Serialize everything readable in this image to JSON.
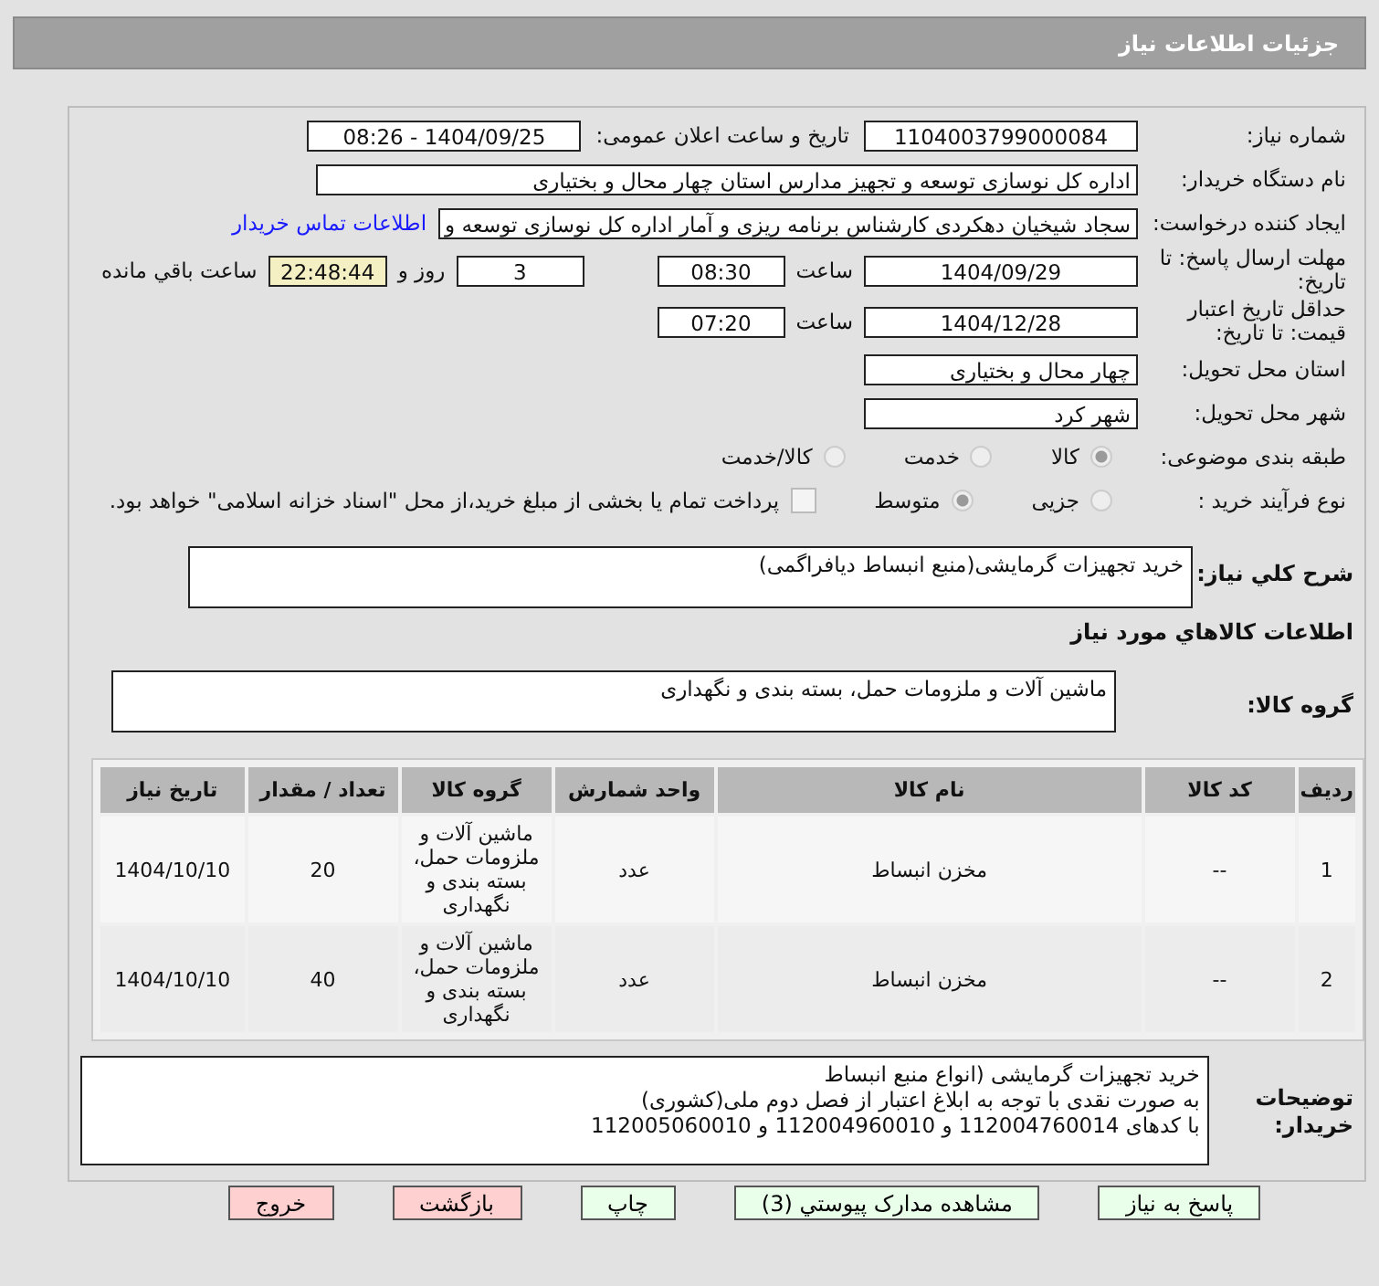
{
  "header": {
    "title": "جزئیات اطلاعات نیاز"
  },
  "need_number": {
    "label": "شماره نیاز:",
    "value": "1104003799000084"
  },
  "announce": {
    "label": "تاریخ و ساعت اعلان عمومی:",
    "value": "1404/09/25 - 08:26"
  },
  "buyer": {
    "label": "نام دستگاه خریدار:",
    "value": "اداره کل نوسازی  توسعه و تجهیز مدارس استان چهار محال و بختیاری"
  },
  "creator": {
    "label": "ایجاد کننده درخواست:",
    "value": "سجاد شیخیان دهکردی کارشناس برنامه ریزی و آمار اداره کل نوسازی  توسعه و",
    "link": "اطلاعات تماس خریدار"
  },
  "deadline": {
    "label": "مهلت ارسال پاسخ: تا تاریخ:",
    "date": "1404/09/29",
    "time_label": "ساعت",
    "time": "08:30",
    "days": "3",
    "days_label": "روز و",
    "remaining": "22:48:44",
    "remaining_label": "ساعت باقي مانده"
  },
  "validity": {
    "label": "حداقل تاریخ اعتبار قیمت: تا تاریخ:",
    "date": "1404/12/28",
    "time_label": "ساعت",
    "time": "07:20"
  },
  "province": {
    "label": "استان محل تحویل:",
    "value": "چهار محال و بختیاری"
  },
  "city": {
    "label": "شهر محل تحویل:",
    "value": "شهر کرد"
  },
  "category": {
    "label": "طبقه بندی موضوعی:",
    "options": [
      {
        "label": "کالا",
        "selected": true
      },
      {
        "label": "خدمت",
        "selected": false
      },
      {
        "label": "کالا/خدمت",
        "selected": false
      }
    ]
  },
  "process": {
    "label": "نوع فرآیند خرید :",
    "options": [
      {
        "label": "جزیی",
        "selected": false
      },
      {
        "label": "متوسط",
        "selected": true
      }
    ],
    "payment": {
      "checked": false,
      "label": "پرداخت تمام یا بخشی از مبلغ خرید،از محل \"اسناد خزانه اسلامی\" خواهد بود."
    }
  },
  "summary": {
    "label": "شرح کلي نياز:",
    "value": "خرید تجهیزات گرمایشی(منبع انبساط دیافراگمی)"
  },
  "goods_title": "اطلاعات کالاهاي مورد نياز",
  "goods_group": {
    "label": "گروه کالا:",
    "value": "ماشین آلات و ملزومات حمل، بسته بندی و نگهداری"
  },
  "table": {
    "columns": [
      "رديف",
      "کد کالا",
      "نام کالا",
      "واحد شمارش",
      "گروه کالا",
      "تعداد / مقدار",
      "تاريخ نياز"
    ],
    "rows": [
      [
        "1",
        "--",
        "مخزن انبساط",
        "عدد",
        "ماشین آلات و ملزومات حمل، بسته بندی و نگهداری",
        "20",
        "1404/10/10"
      ],
      [
        "2",
        "--",
        "مخزن انبساط",
        "عدد",
        "ماشین آلات و ملزومات حمل، بسته بندی و نگهداری",
        "40",
        "1404/10/10"
      ]
    ]
  },
  "notes": {
    "label": "توضیحات خریدار:",
    "lines": [
      "خرید تجهیزات گرمایشی (انواع منبع انبساط",
      "به صورت نقدی با توجه به ابلاغ اعتبار از فصل دوم ملی(کشوری)",
      "با کدهای 112004760014 و 112004960010 و 112005060010"
    ]
  },
  "buttons": [
    {
      "label": "پاسخ به نياز",
      "kind": "green"
    },
    {
      "label": "مشاهده مدارک پيوستي (3)",
      "kind": "green"
    },
    {
      "label": "چاپ",
      "kind": "green"
    },
    {
      "label": "بازگشت",
      "kind": "red"
    },
    {
      "label": "خروج",
      "kind": "red"
    }
  ]
}
